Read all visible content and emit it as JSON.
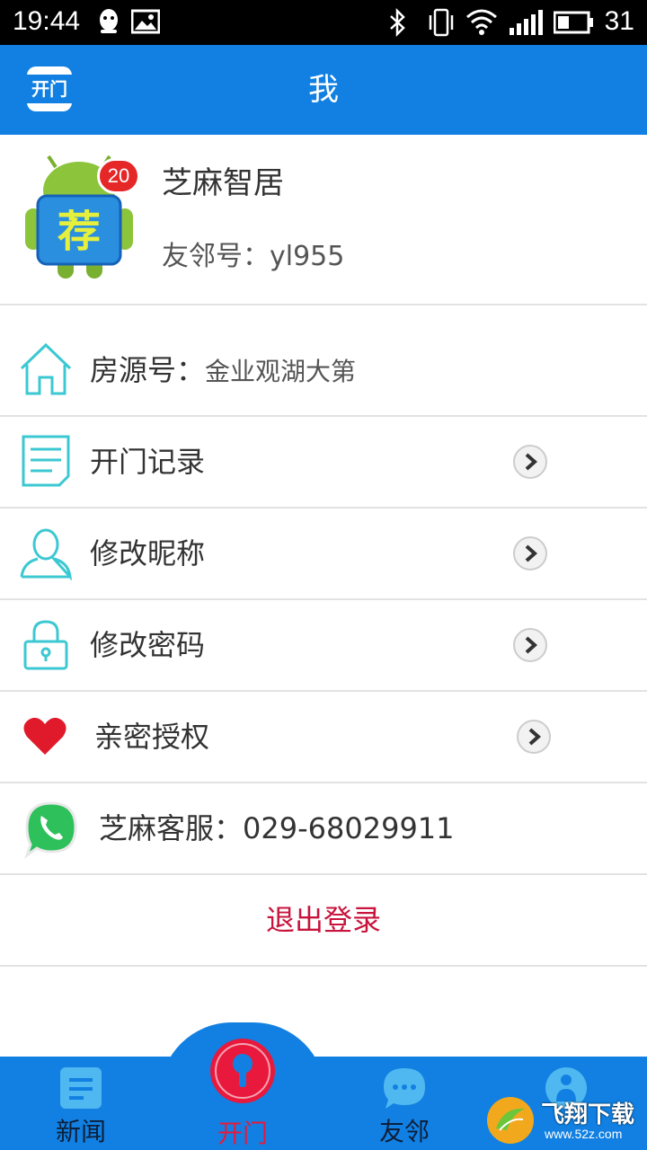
{
  "status_bar": {
    "time": "19:44",
    "battery": "31"
  },
  "app_bar": {
    "logo_text": "开门",
    "title": "我"
  },
  "profile": {
    "name": "芝麻智居",
    "badge_count": "20",
    "user_id": "友邻号：yl955"
  },
  "menu": {
    "house": {
      "label": "房源号：",
      "value": "金业观湖大第"
    },
    "records": {
      "label": "开门记录"
    },
    "nickname": {
      "label": "修改昵称"
    },
    "password": {
      "label": "修改密码"
    },
    "auth": {
      "label": "亲密授权"
    },
    "service": {
      "label": "芝麻客服：",
      "value": "029-68029911"
    }
  },
  "logout": {
    "label": "退出登录"
  },
  "tabs": [
    {
      "label": "新闻"
    },
    {
      "label": "开门"
    },
    {
      "label": "友邻"
    }
  ],
  "watermark": {
    "text": "飞翔下载",
    "url": "www.52z.com"
  },
  "colors": {
    "primary": "#1180e2",
    "accent_red": "#e8193c",
    "logout_red": "#c8143c",
    "icon_teal": "#3cc8d2"
  }
}
